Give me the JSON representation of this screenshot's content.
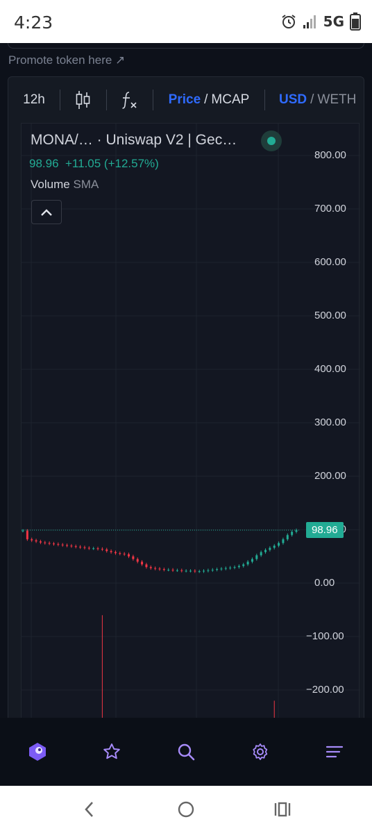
{
  "status_bar": {
    "time": "4:23",
    "network": "5G",
    "icons": [
      "alarm-icon",
      "signal-icon",
      "battery-icon"
    ]
  },
  "promote": {
    "text": "Promote token here ↗"
  },
  "toolbar": {
    "interval": "12h",
    "icons": [
      "candles-icon",
      "indicators-icon"
    ],
    "price_label": "Price",
    "mcap_label": "MCAP",
    "usd_label": "USD",
    "weth_label": "WETH",
    "separator": "/"
  },
  "legend": {
    "title": "MONA/…   · Uniswap V2 | Gec…",
    "last": "98.96",
    "change": "+11.05 (+12.57%)",
    "volume_label": "Volume",
    "volume_indicator": "SMA"
  },
  "colors": {
    "up": "#22ab94",
    "down": "#f23645",
    "accent": "#2f6bff",
    "nav_icon": "#a78bfa"
  },
  "chart_data": {
    "type": "candlestick",
    "title": "",
    "y_ticks": [
      "800.00",
      "700.00",
      "600.00",
      "500.00",
      "400.00",
      "300.00",
      "200.00",
      "100.00",
      "0.00",
      "−100.00",
      "−200.00"
    ],
    "y_tick_values": [
      800,
      700,
      600,
      500,
      400,
      300,
      200,
      100,
      0,
      -100,
      -200
    ],
    "ylim": [
      -250,
      830
    ],
    "last_price": 98.96,
    "last_price_label": "98.96",
    "price_series": [
      98,
      82,
      80,
      78,
      76,
      75,
      74,
      73,
      72,
      71,
      70,
      69,
      68,
      67,
      66,
      65,
      65,
      64,
      63,
      60,
      58,
      56,
      55,
      54,
      50,
      45,
      40,
      35,
      30,
      28,
      27,
      26,
      25,
      25,
      24,
      24,
      23,
      23,
      23,
      22,
      22,
      23,
      24,
      25,
      26,
      27,
      28,
      29,
      30,
      32,
      35,
      40,
      45,
      52,
      58,
      62,
      66,
      70,
      75,
      82,
      90,
      96,
      99
    ],
    "volume_spikes": [
      {
        "index": 18,
        "value": -60
      },
      {
        "index": 57,
        "value": -220
      }
    ]
  },
  "bottom_nav": {
    "items": [
      "app-logo-icon",
      "star-icon",
      "search-icon",
      "settings-icon",
      "menu-icon"
    ]
  },
  "system_nav": {
    "items": [
      "back-icon",
      "home-icon",
      "recents-icon"
    ]
  }
}
